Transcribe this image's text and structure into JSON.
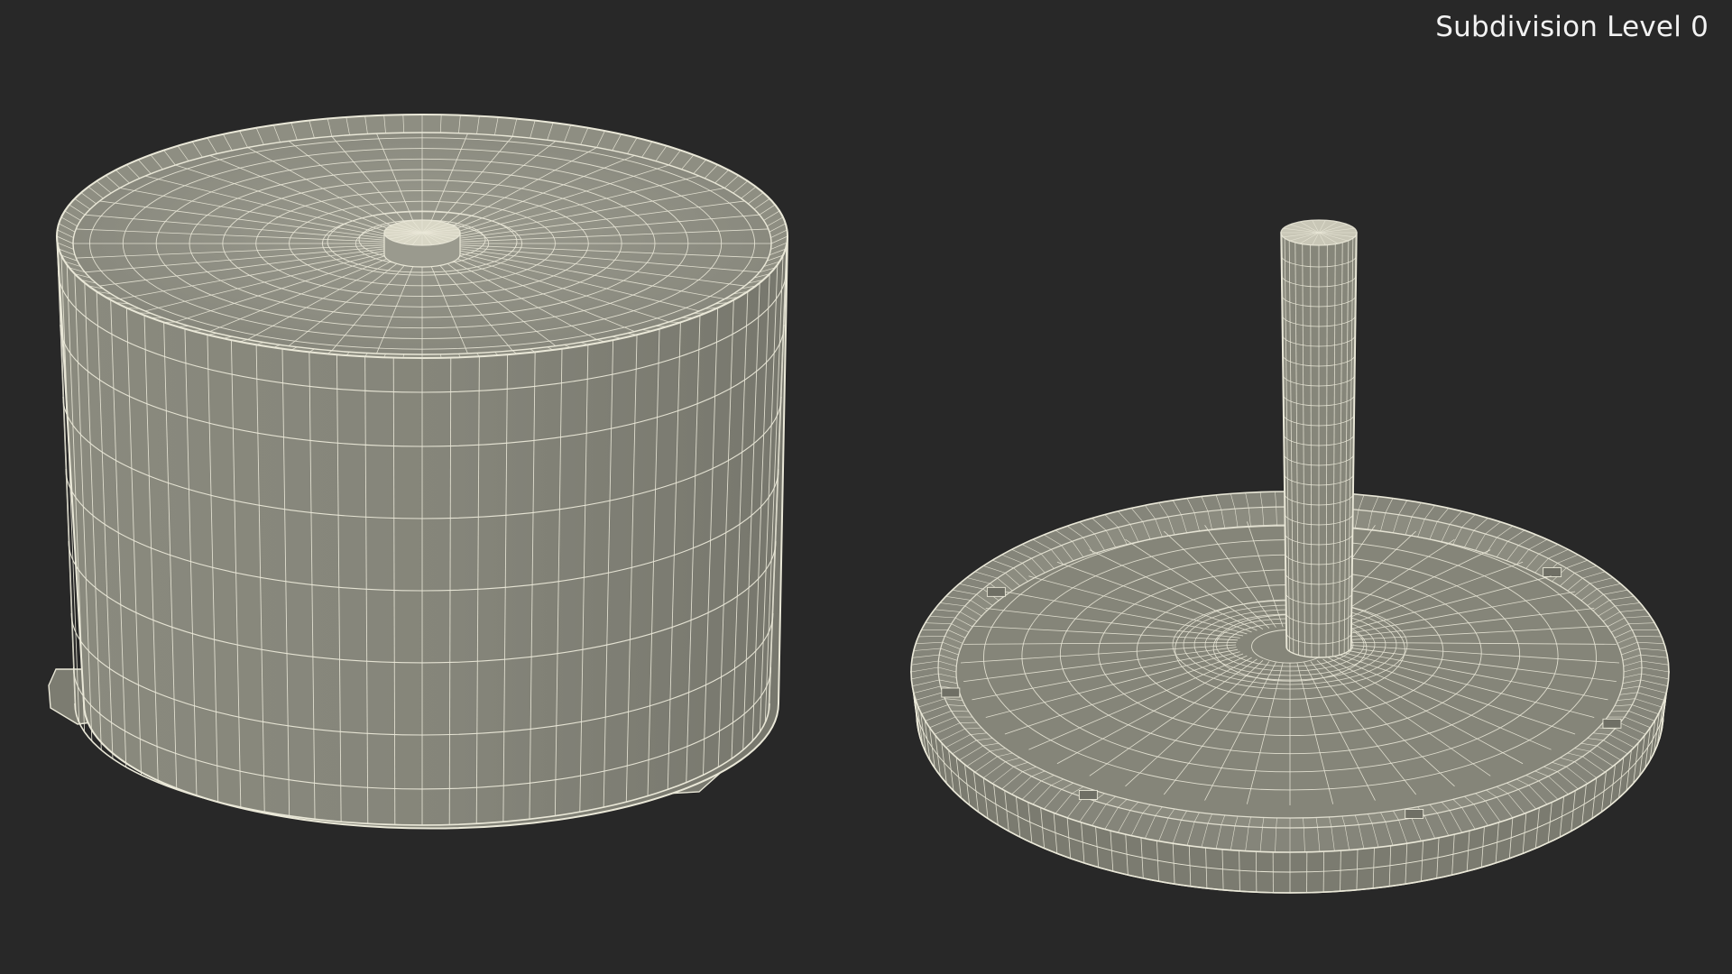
{
  "viewport": {
    "label": "Subdivision Level 0",
    "background_color": "#282828",
    "surface_color": "#87877a",
    "wire_color": "#eae8d8"
  },
  "objects": [
    {
      "name": "cylinder-container-body"
    },
    {
      "name": "spindle-base"
    }
  ]
}
